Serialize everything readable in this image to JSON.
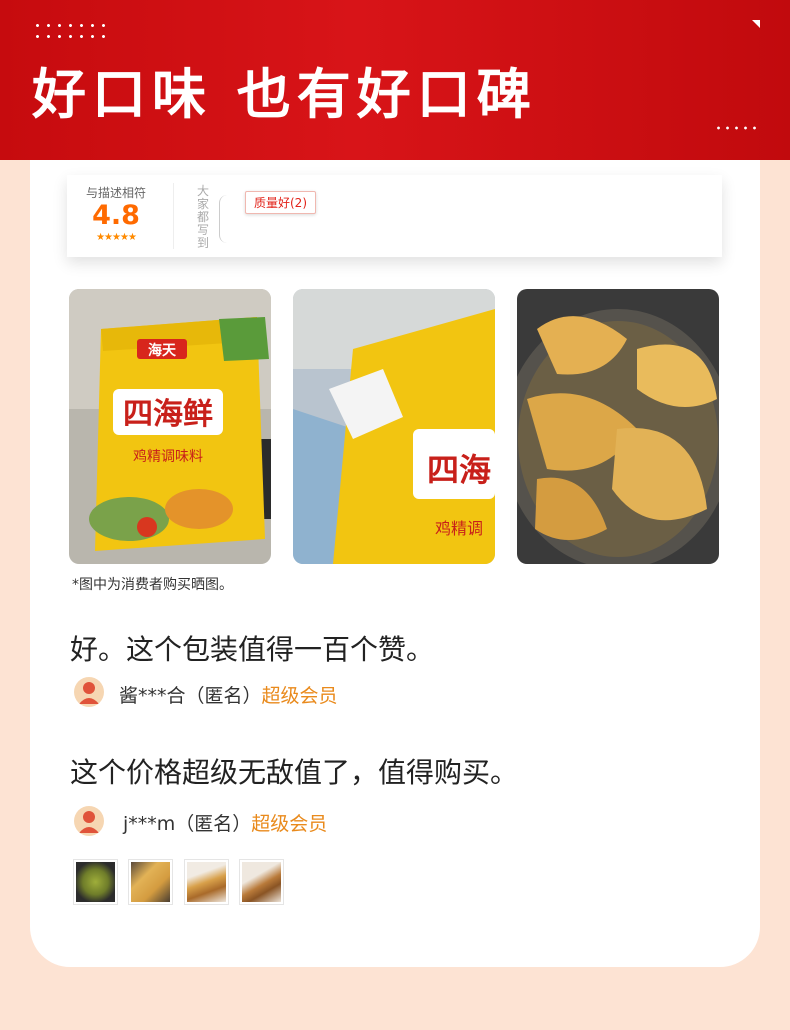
{
  "banner": {
    "title": "好口味 也有好口碑"
  },
  "rating": {
    "label": "与描述相符",
    "score": "4.8",
    "stars": "★★★★★",
    "vertical_label": "大家都写到",
    "tag": "质量好(2)"
  },
  "photos": [
    {
      "name": "product-bag-front",
      "brand": "海天",
      "title": "四海鲜",
      "subtitle": "鸡精调味料"
    },
    {
      "name": "product-bag-side",
      "title": "四海",
      "subtitle": "鸡精调"
    },
    {
      "name": "cooked-chicken-wings"
    }
  ],
  "caption": "*图中为消费者购买晒图。",
  "reviews": [
    {
      "text": "好。这个包装值得一百个赞。",
      "user": "酱***合（匿名）",
      "member": "超级会员"
    },
    {
      "text": "这个价格超级无敌值了，值得购买。",
      "user": "j***m（匿名）",
      "member": "超级会员"
    }
  ],
  "colors": {
    "banner_red": "#c60b0e",
    "score_orange": "#ff6a00",
    "member_orange": "#e98a1c",
    "background": "#fde3d3"
  }
}
